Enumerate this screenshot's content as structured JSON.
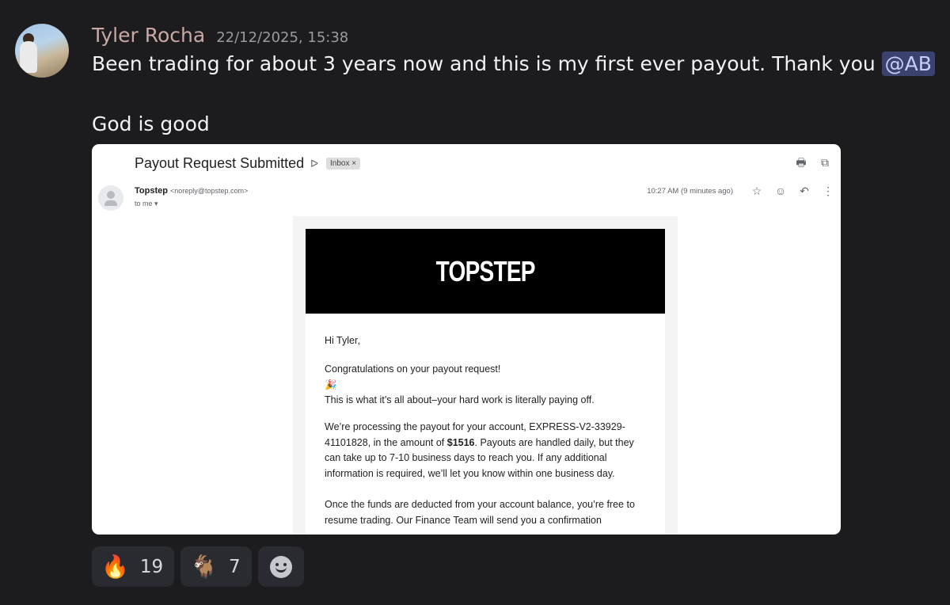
{
  "message": {
    "author": "Tyler Rocha",
    "timestamp": "22/12/2025, 15:38",
    "line1_text": "Been trading for about 3 years now and this is my first ever payout. Thank you ",
    "mention": "@AB",
    "line2_text": "God is good"
  },
  "email": {
    "subject": "Payout Request Submitted",
    "label_chip": "Inbox ×",
    "sender_name": "Topstep",
    "sender_email": "<noreply@topstep.com>",
    "to_me": "to me ▾",
    "time": "10:27 AM (9 minutes ago)",
    "logo": "TOPSTEP",
    "greeting": "Hi Tyler,",
    "congrats": "Congratulations on your payout request!",
    "party_emoji": "🎉",
    "tagline": "This is what it’s all about–your hard work is literally paying off.",
    "para1_a": "We’re processing the payout for your account, EXPRESS-V2-33929-41101828, in the amount of ",
    "amount": "$1516",
    "para1_b": ". Payouts are handled daily, but they can take up to 7-10 business days to reach you. If any additional information is required, we’ll let you know within one business day.",
    "para2": "Once the funds are deducted from your account balance, you’re free to resume trading. Our Finance Team will send you a confirmation"
  },
  "reactions": [
    {
      "emoji": "🔥",
      "count": "19"
    },
    {
      "emoji": "🐐",
      "count": "7"
    }
  ],
  "icons": {
    "print": "🖶",
    "open": "⧉",
    "star": "☆",
    "emoji": "☺",
    "reply": "↶",
    "more": "⋮",
    "important": "ᐅ"
  }
}
